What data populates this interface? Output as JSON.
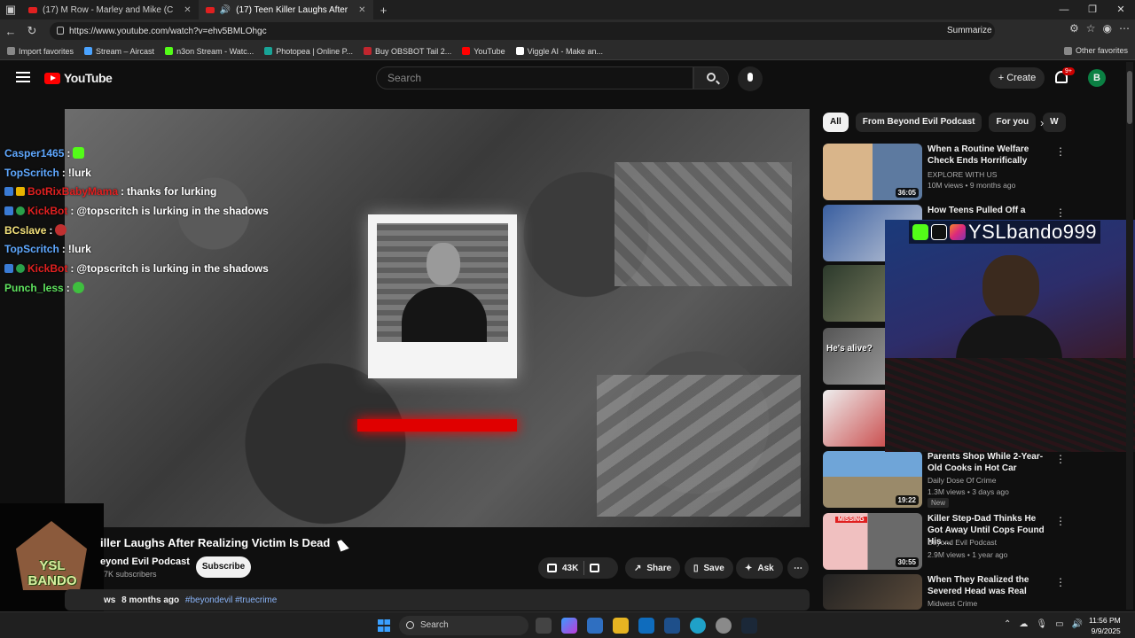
{
  "browser": {
    "tabs": [
      {
        "title": "(17) M Row - Marley and Mike (C"
      },
      {
        "title": "(17) Teen Killer Laughs After"
      }
    ],
    "url": "https://www.youtube.com/watch?v=ehv5BMLOhgc",
    "summarize_label": "Summarize",
    "bookmarks": [
      "Import favorites",
      "Stream – Aircast",
      "n3on Stream - Watc...",
      "Photopea | Online P...",
      "Buy OBSBOT Tail 2...",
      "YouTube",
      "Viggle AI - Make an..."
    ],
    "other_favorites": "Other favorites"
  },
  "youtube": {
    "logo_text": "YouTube",
    "search_placeholder": "Search",
    "create_label": "Create",
    "notification_count": "9+",
    "avatar_letter": "B"
  },
  "overlay": {
    "chat": [
      {
        "user": "Casper1465",
        "msg": "",
        "color": "blue"
      },
      {
        "user": "TopScritch",
        "msg": "!lurk",
        "color": "blue"
      },
      {
        "user": "BotRixBabyMama",
        "msg": "thanks for lurking",
        "color": "red"
      },
      {
        "user": "KickBot",
        "msg": "@topscritch is lurking in the shadows",
        "color": "red"
      },
      {
        "user": "BCslave",
        "msg": "",
        "color": "yellow"
      },
      {
        "user": "TopScritch",
        "msg": "!lurk",
        "color": "blue"
      },
      {
        "user": "KickBot",
        "msg": "@topscritch is lurking in the shadows",
        "color": "red"
      },
      {
        "user": "Punch_less",
        "msg": "",
        "color": "green"
      }
    ],
    "streamer_handle": "YSLbando999",
    "logo_text": "YSL BANDO"
  },
  "video": {
    "title": "iller Laughs After Realizing Victim Is Dead",
    "channel": "eyond Evil Podcast",
    "subscribers": "7K subscribers",
    "subscribe_label": "Subscribe",
    "likes": "43K",
    "share_label": "Share",
    "save_label": "Save",
    "ask_label": "Ask",
    "views_label": "ws",
    "age": "8 months ago",
    "hashtags": "#beyondevil #truecrime"
  },
  "sidebar": {
    "chips": [
      "All",
      "From Beyond Evil Podcast",
      "For you",
      "W"
    ],
    "recommendations": [
      {
        "title": "When a Routine Welfare Check Ends Horrifically",
        "channel": "EXPLORE WITH US",
        "meta": "10M views • 9 months ago",
        "duration": "36:05"
      },
      {
        "title": "How Teens Pulled Off a",
        "channel": "",
        "meta": "",
        "duration": ""
      },
      {
        "title": "",
        "channel": "",
        "meta": "",
        "duration": ""
      },
      {
        "title": "",
        "channel": "",
        "meta": "",
        "duration": "",
        "thumb_text": "He's alive?"
      },
      {
        "title": "",
        "channel": "",
        "meta": "",
        "duration": ""
      },
      {
        "title": "Parents Shop While 2-Year-Old Cooks in Hot Car",
        "channel": "Daily Dose Of Crime",
        "meta": "1.3M views • 3 days ago",
        "duration": "19:22",
        "badge": "New"
      },
      {
        "title": "Killer Step-Dad Thinks He Got Away Until Cops Found His ...",
        "channel": "Beyond Evil Podcast",
        "meta": "2.9M views • 1 year ago",
        "duration": "30:55",
        "thumb_text": "MISSING"
      },
      {
        "title": "When They Realized the Severed Head was Real",
        "channel": "Midwest Crime",
        "meta": "",
        "duration": ""
      }
    ]
  },
  "taskbar": {
    "search_placeholder": "Search",
    "time": "11:56 PM",
    "date": "9/9/2025"
  },
  "colors": {
    "yt_red": "#ff0000",
    "chip_active": "#f1f1f1",
    "background": "#0f0f0f",
    "chat_blue": "#5fa8ff",
    "chat_red": "#e02020"
  }
}
